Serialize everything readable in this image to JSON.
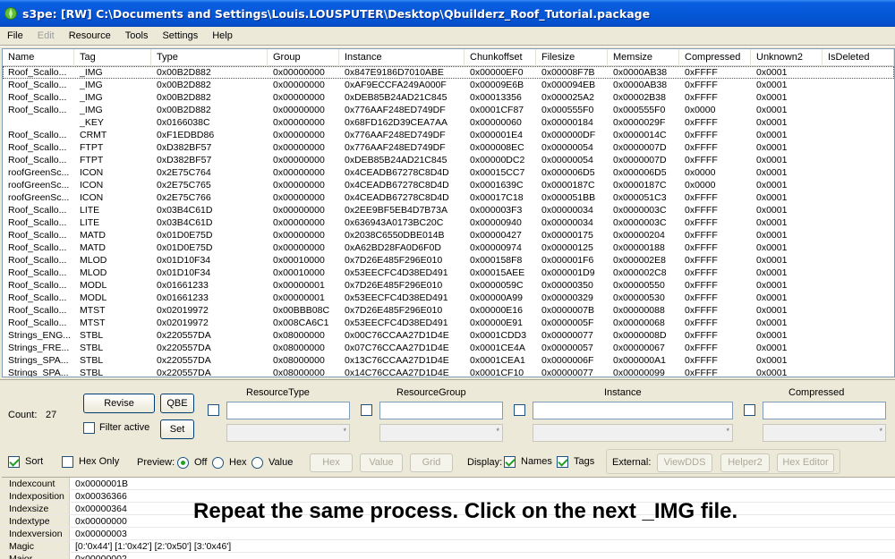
{
  "window": {
    "title": "s3pe: [RW] C:\\Documents and Settings\\Louis.LOUSPUTER\\Desktop\\Qbuilderz_Roof_Tutorial.package"
  },
  "menu": [
    {
      "label": "File",
      "disabled": false
    },
    {
      "label": "Edit",
      "disabled": true
    },
    {
      "label": "Resource",
      "disabled": false
    },
    {
      "label": "Tools",
      "disabled": false
    },
    {
      "label": "Settings",
      "disabled": false
    },
    {
      "label": "Help",
      "disabled": false
    }
  ],
  "grid": {
    "columns": [
      "Name",
      "Tag",
      "Type",
      "Group",
      "Instance",
      "Chunkoffset",
      "Filesize",
      "Memsize",
      "Compressed",
      "Unknown2",
      "IsDeleted"
    ],
    "rows": [
      [
        "Roof_Scallo...",
        "_IMG",
        "0x00B2D882",
        "0x00000000",
        "0x847E9186D7010ABE",
        "0x00000EF0",
        "0x00008F7B",
        "0x0000AB38",
        "0xFFFF",
        "0x0001",
        ""
      ],
      [
        "Roof_Scallo...",
        "_IMG",
        "0x00B2D882",
        "0x00000000",
        "0xAF9ECCFA249A000F",
        "0x00009E6B",
        "0x000094EB",
        "0x0000AB38",
        "0xFFFF",
        "0x0001",
        ""
      ],
      [
        "Roof_Scallo...",
        "_IMG",
        "0x00B2D882",
        "0x00000000",
        "0xDEB85B24AD21C845",
        "0x00013356",
        "0x000025A2",
        "0x00002B38",
        "0xFFFF",
        "0x0001",
        ""
      ],
      [
        "Roof_Scallo...",
        "_IMG",
        "0x00B2D882",
        "0x00000000",
        "0x776AAF248ED749DF",
        "0x0001CF87",
        "0x000555F0",
        "0x000555F0",
        "0x0000",
        "0x0001",
        ""
      ],
      [
        "",
        "_KEY",
        "0x0166038C",
        "0x00000000",
        "0x68FD162D39CEA7AA",
        "0x00000060",
        "0x00000184",
        "0x0000029F",
        "0xFFFF",
        "0x0001",
        ""
      ],
      [
        "Roof_Scallo...",
        "CRMT",
        "0xF1EDBD86",
        "0x00000000",
        "0x776AAF248ED749DF",
        "0x000001E4",
        "0x000000DF",
        "0x0000014C",
        "0xFFFF",
        "0x0001",
        ""
      ],
      [
        "Roof_Scallo...",
        "FTPT",
        "0xD382BF57",
        "0x00000000",
        "0x776AAF248ED749DF",
        "0x000008EC",
        "0x00000054",
        "0x0000007D",
        "0xFFFF",
        "0x0001",
        ""
      ],
      [
        "Roof_Scallo...",
        "FTPT",
        "0xD382BF57",
        "0x00000000",
        "0xDEB85B24AD21C845",
        "0x00000DC2",
        "0x00000054",
        "0x0000007D",
        "0xFFFF",
        "0x0001",
        ""
      ],
      [
        "roofGreenSc...",
        "ICON",
        "0x2E75C764",
        "0x00000000",
        "0x4CEADB67278C8D4D",
        "0x00015CC7",
        "0x000006D5",
        "0x000006D5",
        "0x0000",
        "0x0001",
        ""
      ],
      [
        "roofGreenSc...",
        "ICON",
        "0x2E75C765",
        "0x00000000",
        "0x4CEADB67278C8D4D",
        "0x0001639C",
        "0x0000187C",
        "0x0000187C",
        "0x0000",
        "0x0001",
        ""
      ],
      [
        "roofGreenSc...",
        "ICON",
        "0x2E75C766",
        "0x00000000",
        "0x4CEADB67278C8D4D",
        "0x00017C18",
        "0x000051BB",
        "0x000051C3",
        "0xFFFF",
        "0x0001",
        ""
      ],
      [
        "Roof_Scallo...",
        "LITE",
        "0x03B4C61D",
        "0x00000000",
        "0x2EE9BF5EB4D7B73A",
        "0x000003F3",
        "0x00000034",
        "0x0000003C",
        "0xFFFF",
        "0x0001",
        ""
      ],
      [
        "Roof_Scallo...",
        "LITE",
        "0x03B4C61D",
        "0x00000000",
        "0x636943A0173BC20C",
        "0x00000940",
        "0x00000034",
        "0x0000003C",
        "0xFFFF",
        "0x0001",
        ""
      ],
      [
        "Roof_Scallo...",
        "MATD",
        "0x01D0E75D",
        "0x00000000",
        "0x2038C6550DBE014B",
        "0x00000427",
        "0x00000175",
        "0x00000204",
        "0xFFFF",
        "0x0001",
        ""
      ],
      [
        "Roof_Scallo...",
        "MATD",
        "0x01D0E75D",
        "0x00000000",
        "0xA62BD28FA0D6F0D",
        "0x00000974",
        "0x00000125",
        "0x00000188",
        "0xFFFF",
        "0x0001",
        ""
      ],
      [
        "Roof_Scallo...",
        "MLOD",
        "0x01D10F34",
        "0x00010000",
        "0x7D26E485F296E010",
        "0x000158F8",
        "0x000001F6",
        "0x000002E8",
        "0xFFFF",
        "0x0001",
        ""
      ],
      [
        "Roof_Scallo...",
        "MLOD",
        "0x01D10F34",
        "0x00010000",
        "0x53EECFC4D38ED491",
        "0x00015AEE",
        "0x000001D9",
        "0x000002C8",
        "0xFFFF",
        "0x0001",
        ""
      ],
      [
        "Roof_Scallo...",
        "MODL",
        "0x01661233",
        "0x00000001",
        "0x7D26E485F296E010",
        "0x0000059C",
        "0x00000350",
        "0x00000550",
        "0xFFFF",
        "0x0001",
        ""
      ],
      [
        "Roof_Scallo...",
        "MODL",
        "0x01661233",
        "0x00000001",
        "0x53EECFC4D38ED491",
        "0x00000A99",
        "0x00000329",
        "0x00000530",
        "0xFFFF",
        "0x0001",
        ""
      ],
      [
        "Roof_Scallo...",
        "MTST",
        "0x02019972",
        "0x00BBB08C",
        "0x7D26E485F296E010",
        "0x00000E16",
        "0x0000007B",
        "0x00000088",
        "0xFFFF",
        "0x0001",
        ""
      ],
      [
        "Roof_Scallo...",
        "MTST",
        "0x02019972",
        "0x008CA6C1",
        "0x53EECFC4D38ED491",
        "0x00000E91",
        "0x0000005F",
        "0x00000068",
        "0xFFFF",
        "0x0001",
        ""
      ],
      [
        "Strings_ENG...",
        "STBL",
        "0x220557DA",
        "0x08000000",
        "0x00C76CCAA27D1D4E",
        "0x0001CDD3",
        "0x00000077",
        "0x0000008D",
        "0xFFFF",
        "0x0001",
        ""
      ],
      [
        "Strings_FRE...",
        "STBL",
        "0x220557DA",
        "0x08000000",
        "0x07C76CCAA27D1D4E",
        "0x0001CE4A",
        "0x00000057",
        "0x00000067",
        "0xFFFF",
        "0x0001",
        ""
      ],
      [
        "Strings_SPA...",
        "STBL",
        "0x220557DA",
        "0x08000000",
        "0x13C76CCAA27D1D4E",
        "0x0001CEA1",
        "0x0000006F",
        "0x000000A1",
        "0xFFFF",
        "0x0001",
        ""
      ],
      [
        "Strings_SPA...",
        "STBL",
        "0x220557DA",
        "0x08000000",
        "0x14C76CCAA27D1D4E",
        "0x0001CF10",
        "0x00000077",
        "0x00000099",
        "0xFFFF",
        "0x0001",
        ""
      ]
    ]
  },
  "filter": {
    "count_label": "Count:",
    "count_value": "27",
    "revise_label": "Revise",
    "qbe_label": "QBE",
    "set_label": "Set",
    "filter_active_label": "Filter active",
    "filter_active_checked": false,
    "fields": [
      {
        "label": "ResourceType",
        "checked": false,
        "value": ""
      },
      {
        "label": "ResourceGroup",
        "checked": false,
        "value": ""
      },
      {
        "label": "Instance",
        "checked": false,
        "value": ""
      },
      {
        "label": "Compressed",
        "checked": false,
        "value": ""
      }
    ],
    "combo_marker": "*"
  },
  "options": {
    "sort_label": "Sort",
    "sort_checked": true,
    "hex_only_label": "Hex Only",
    "hex_only_checked": false,
    "preview_label": "Preview:",
    "preview_off": "Off",
    "preview_hex": "Hex",
    "preview_value": "Value",
    "preview_selected": "Off",
    "btn_hex": "Hex",
    "btn_value": "Value",
    "btn_grid": "Grid",
    "display_label": "Display:",
    "names_label": "Names",
    "names_checked": true,
    "tags_label": "Tags",
    "tags_checked": true,
    "external_label": "External:",
    "viewdds_label": "ViewDDS",
    "helper2_label": "Helper2",
    "hex_editor_label": "Hex Editor"
  },
  "properties": [
    {
      "key": "Indexcount",
      "value": "0x0000001B"
    },
    {
      "key": "Indexposition",
      "value": "0x00036366"
    },
    {
      "key": "Indexsize",
      "value": "0x00000364"
    },
    {
      "key": "Indextype",
      "value": "0x00000000"
    },
    {
      "key": "Indexversion",
      "value": "0x00000003"
    },
    {
      "key": "Magic",
      "value": "[0:'0x44'] [1:'0x42'] [2:'0x50'] [3:'0x46']"
    },
    {
      "key": "Major",
      "value": "0x00000002"
    }
  ],
  "caption": "Repeat the same process. Click on the next _IMG file."
}
